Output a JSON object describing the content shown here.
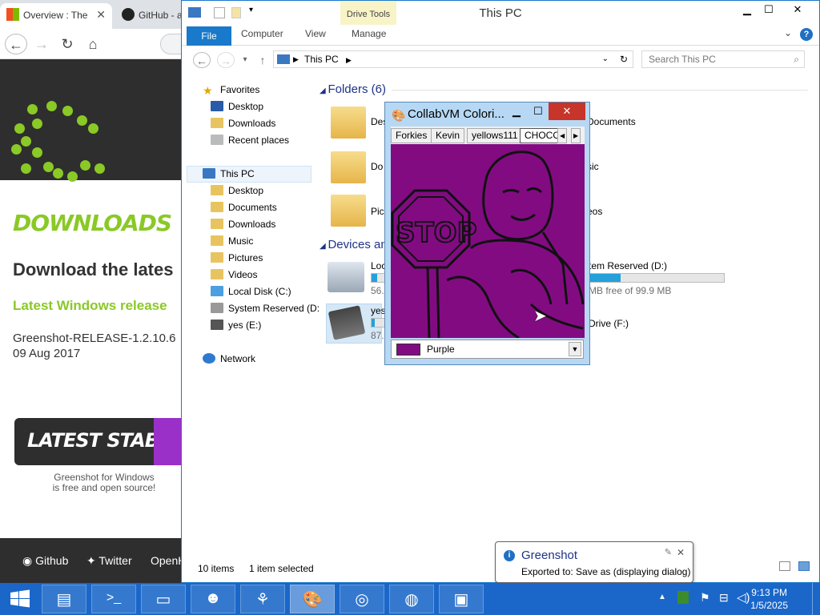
{
  "browser": {
    "tabs": [
      {
        "label": "Overview : The"
      },
      {
        "label": "GitHub - a"
      }
    ],
    "page": {
      "heading": "DOWNLOADS",
      "latest": "Download the lates",
      "windows_release": "Latest Windows release",
      "filename": "Greenshot-RELEASE-1.2.10.6",
      "date": "09 Aug 2017",
      "stable_button": "LATEST STABLE",
      "stable_caption_line1": "Greenshot for Windows",
      "stable_caption_line2": "is free and open source!",
      "footer_links": [
        "Github",
        "Twitter",
        "OpenH"
      ]
    }
  },
  "explorer": {
    "title": "This PC",
    "context_tab": "Drive Tools",
    "ribbon_tabs": [
      "File",
      "Computer",
      "View",
      "Manage"
    ],
    "address": "This PC",
    "search_placeholder": "Search This PC",
    "nav": {
      "favorites": "Favorites",
      "fav_items": [
        "Desktop",
        "Downloads",
        "Recent places"
      ],
      "this_pc": "This PC",
      "pc_items": [
        "Desktop",
        "Documents",
        "Downloads",
        "Music",
        "Pictures",
        "Videos",
        "Local Disk (C:)",
        "System Reserved (D:",
        "yes (E:)"
      ],
      "network": "Network"
    },
    "folders_header": "Folders (6)",
    "folders": [
      "Des",
      "Documents",
      "Do",
      "sic",
      "Pic",
      "eos"
    ],
    "devices_header": "Devices and",
    "drives": [
      {
        "label": "Loc",
        "free_text": "56.",
        "fill_pct": 0.4
      },
      {
        "label": "tem Reserved (D:)",
        "free_text": "MB free of 99.9 MB",
        "fill_pct": 0.23
      },
      {
        "label": "yes",
        "free_text": "87.",
        "fill_pct": 0.2
      },
      {
        "label": "Drive (F:)",
        "free_text": "",
        "fill_pct": 0
      }
    ],
    "status_items": "10 items",
    "status_selected": "1 item selected"
  },
  "collab": {
    "title": "CollabVM Colori...",
    "user_tabs": [
      "Forkies",
      "Kevin",
      "yellows111",
      "CHOCO"
    ],
    "canvas_text": "STOP",
    "color_label": "Purple",
    "colors": {
      "canvas": "#820b82"
    }
  },
  "balloon": {
    "title": "Greenshot",
    "message": "Exported to: Save as (displaying dialog)"
  },
  "taskbar": {
    "time": "9:13 PM",
    "date": "1/5/2025"
  }
}
